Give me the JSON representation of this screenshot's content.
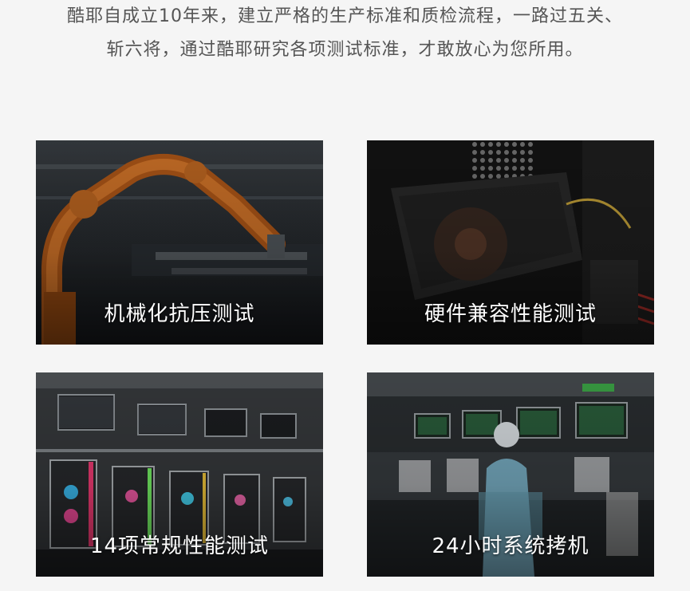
{
  "intro": {
    "line1": "酷耶自成立10年来，建立严格的生产标准和质检流程，一路过五关、",
    "line2": "斩六将，通过酷耶研究各项测试标准，才敢放心为您所用。"
  },
  "cards": [
    {
      "caption": "机械化抗压测试"
    },
    {
      "caption": "硬件兼容性能测试"
    },
    {
      "caption": "14项常规性能测试"
    },
    {
      "caption": "24小时系统拷机"
    }
  ]
}
